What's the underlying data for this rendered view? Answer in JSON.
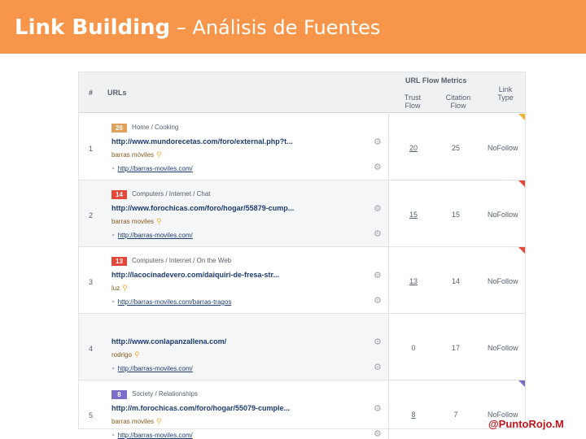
{
  "header": {
    "title_strong": "Link Building",
    "title_rest": " – Análisis de Fuentes",
    "background_color": "#f7954a"
  },
  "table": {
    "columns": {
      "hash": "#",
      "urls": "URLs",
      "group": "URL Flow Metrics",
      "trust_flow": "Trust Flow",
      "citation_flow": "Citation Flow",
      "link_type": "Link Type"
    },
    "rows": [
      {
        "num": "1",
        "badge": "26",
        "badge_color": "#e0a25a",
        "category": "Home / Cooking",
        "url": "http://www.mundorecetas.com/foro/external.php?t...",
        "anchor": "barras móviles",
        "target": "http://barras-moviles.com/",
        "trust_flow": "20",
        "citation_flow": "25",
        "link_type": "NoFollow",
        "flag_color": "#f0b33a"
      },
      {
        "num": "2",
        "badge": "14",
        "badge_color": "#e5473b",
        "category": "Computers / Internet / Chat",
        "url": "http://www.forochicas.com/foro/hogar/55879-cump...",
        "anchor": "barras moviles",
        "target": "http://barras-moviles.com/",
        "trust_flow": "15",
        "citation_flow": "15",
        "link_type": "NoFollow",
        "flag_color": "#e5473b"
      },
      {
        "num": "3",
        "badge": "13",
        "badge_color": "#e5473b",
        "category": "Computers / Internet / On the Web",
        "url": "http://lacocinadevero.com/daiquiri-de-fresa-str...",
        "anchor": "luz",
        "target": "http://barras-moviles.com/barras-tragos",
        "trust_flow": "13",
        "citation_flow": "14",
        "link_type": "NoFollow",
        "flag_color": "#e5473b"
      },
      {
        "num": "4",
        "badge": "",
        "badge_color": "",
        "category": "",
        "url": "http://www.conlapanzallena.com/",
        "anchor": "rodrigo",
        "target": "http://barras-moviles.com/",
        "trust_flow": "0",
        "citation_flow": "17",
        "link_type": "NoFollow",
        "flag_color": ""
      },
      {
        "num": "5",
        "badge": "8",
        "badge_color": "#7a6ec8",
        "category": "Society / Relationships",
        "url": "http://m.forochicas.com/foro/hogar/55079-cumple...",
        "anchor": "barras moviles",
        "target": "http://barras-moviles.com/",
        "trust_flow": "8",
        "citation_flow": "7",
        "link_type": "NoFollow",
        "flag_color": "#7a6ec8"
      }
    ]
  },
  "footer": {
    "handle": "@PuntoRojo.M",
    "handle_color": "#c0141c"
  },
  "icons": {
    "gear": "gear-icon",
    "key": "key-icon",
    "arrow": "arrow-right-icon"
  }
}
